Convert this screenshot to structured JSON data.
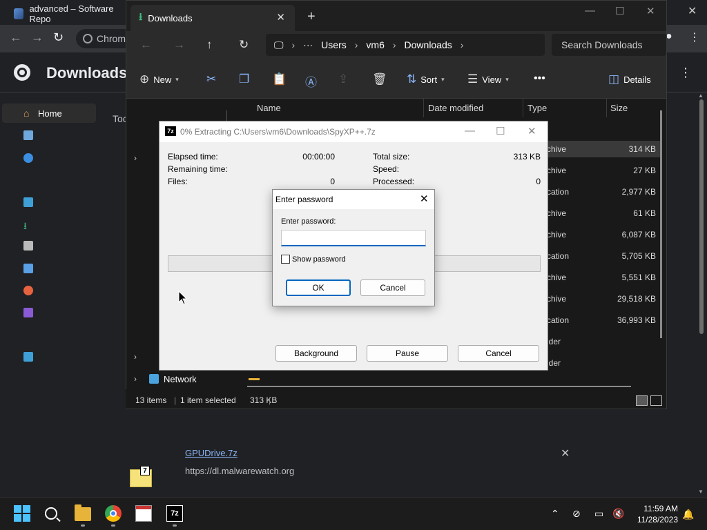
{
  "chrome": {
    "tab_title": "advanced – Software Repo",
    "omnibox_text": "Chrom",
    "page_title": "Downloads",
    "sidebar_text": "Toc",
    "download_item": {
      "file_name": "GPUDrive.7z",
      "url": "https://dl.malwarewatch.org"
    }
  },
  "explorer": {
    "tab_title": "Downloads",
    "breadcrumb": [
      "Users",
      "vm6",
      "Downloads"
    ],
    "search_placeholder": "Search Downloads",
    "commands": {
      "new": "New",
      "sort": "Sort",
      "view": "View",
      "details": "Details"
    },
    "nav": {
      "home": "Home",
      "network": "Network"
    },
    "columns": {
      "name": "Name",
      "date_modified": "Date modified",
      "type": "Type",
      "size": "Size"
    },
    "rows": [
      {
        "type": "chive",
        "size": "314 KB"
      },
      {
        "type": "chive",
        "size": "27 KB"
      },
      {
        "type": "cation",
        "size": "2,977 KB"
      },
      {
        "type": "chive",
        "size": "61 KB"
      },
      {
        "type": "chive",
        "size": "6,087 KB"
      },
      {
        "type": "cation",
        "size": "5,705 KB"
      },
      {
        "type": "chive",
        "size": "5,551 KB"
      },
      {
        "type": "chive",
        "size": "29,518 KB"
      },
      {
        "type": "cation",
        "size": "36,993 KB"
      },
      {
        "type": "lder",
        "size": ""
      },
      {
        "type": "lder",
        "size": ""
      }
    ],
    "status": {
      "items": "13 items",
      "selected": "1 item selected",
      "selected_size": "313 KB"
    }
  },
  "zip_dialog": {
    "title": "0% Extracting C:\\Users\\vm6\\Downloads\\SpyXP++.7z",
    "elapsed_label": "Elapsed time:",
    "elapsed_value": "00:00:00",
    "remaining_label": "Remaining time:",
    "files_label": "Files:",
    "files_value": "0",
    "total_size_label": "Total size:",
    "total_size_value": "313 KB",
    "speed_label": "Speed:",
    "processed_label": "Processed:",
    "processed_value": "0",
    "progress": 0,
    "buttons": {
      "background": "Background",
      "pause": "Pause",
      "cancel": "Cancel"
    }
  },
  "password_dialog": {
    "title": "Enter password",
    "label": "Enter password:",
    "value": "",
    "show_password_label": "Show password",
    "show_password_checked": false,
    "ok": "OK",
    "cancel": "Cancel"
  },
  "taskbar": {
    "time": "11:59 AM",
    "date": "11/28/2023"
  },
  "colors": {
    "accent": "#0067c0",
    "explorer_bg": "#191919",
    "dialog_bg": "#f0f0f0",
    "start_blue": "#4cc2ff"
  }
}
